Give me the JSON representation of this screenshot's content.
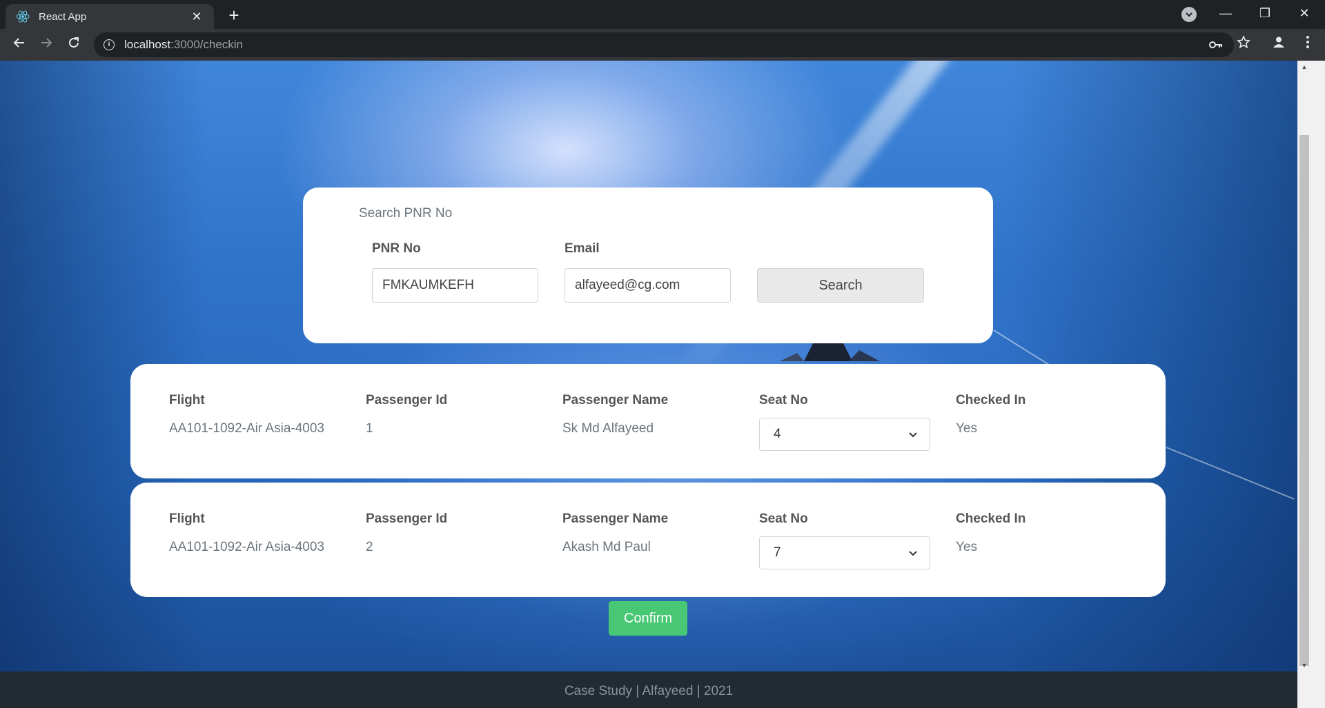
{
  "browser": {
    "tab_title": "React App",
    "tab_close": "✕",
    "new_tab": "+",
    "url_host": "localhost",
    "url_path": ":3000/checkin",
    "window_minimize": "—",
    "window_restore": "❐",
    "window_close": "✕"
  },
  "search_card": {
    "heading": "Search PNR No",
    "pnr_label": "PNR No",
    "pnr_value": "FMKAUMKEFH",
    "email_label": "Email",
    "email_value": "alfayeed@cg.com",
    "search_button": "Search"
  },
  "passengers": [
    {
      "flight_label": "Flight",
      "flight": "AA101-1092-Air Asia-4003",
      "id_label": "Passenger Id",
      "id": "1",
      "name_label": "Passenger Name",
      "name": "Sk Md Alfayeed",
      "seat_label": "Seat No",
      "seat": "4",
      "checked_label": "Checked In",
      "checked": "Yes"
    },
    {
      "flight_label": "Flight",
      "flight": "AA101-1092-Air Asia-4003",
      "id_label": "Passenger Id",
      "id": "2",
      "name_label": "Passenger Name",
      "name": "Akash Md Paul",
      "seat_label": "Seat No",
      "seat": "7",
      "checked_label": "Checked In",
      "checked": "Yes"
    }
  ],
  "confirm_button": "Confirm",
  "footer": "Case Study | Alfayeed | 2021",
  "colors": {
    "confirm": "#48c774",
    "footer_bg": "#222a33",
    "chrome_bg": "#202124"
  },
  "icons": [
    "react-favicon-icon",
    "back-arrow-icon",
    "forward-arrow-icon",
    "reload-icon",
    "info-icon",
    "key-icon",
    "star-icon",
    "profile-icon",
    "menu-dots-icon",
    "chevron-down-icon"
  ]
}
